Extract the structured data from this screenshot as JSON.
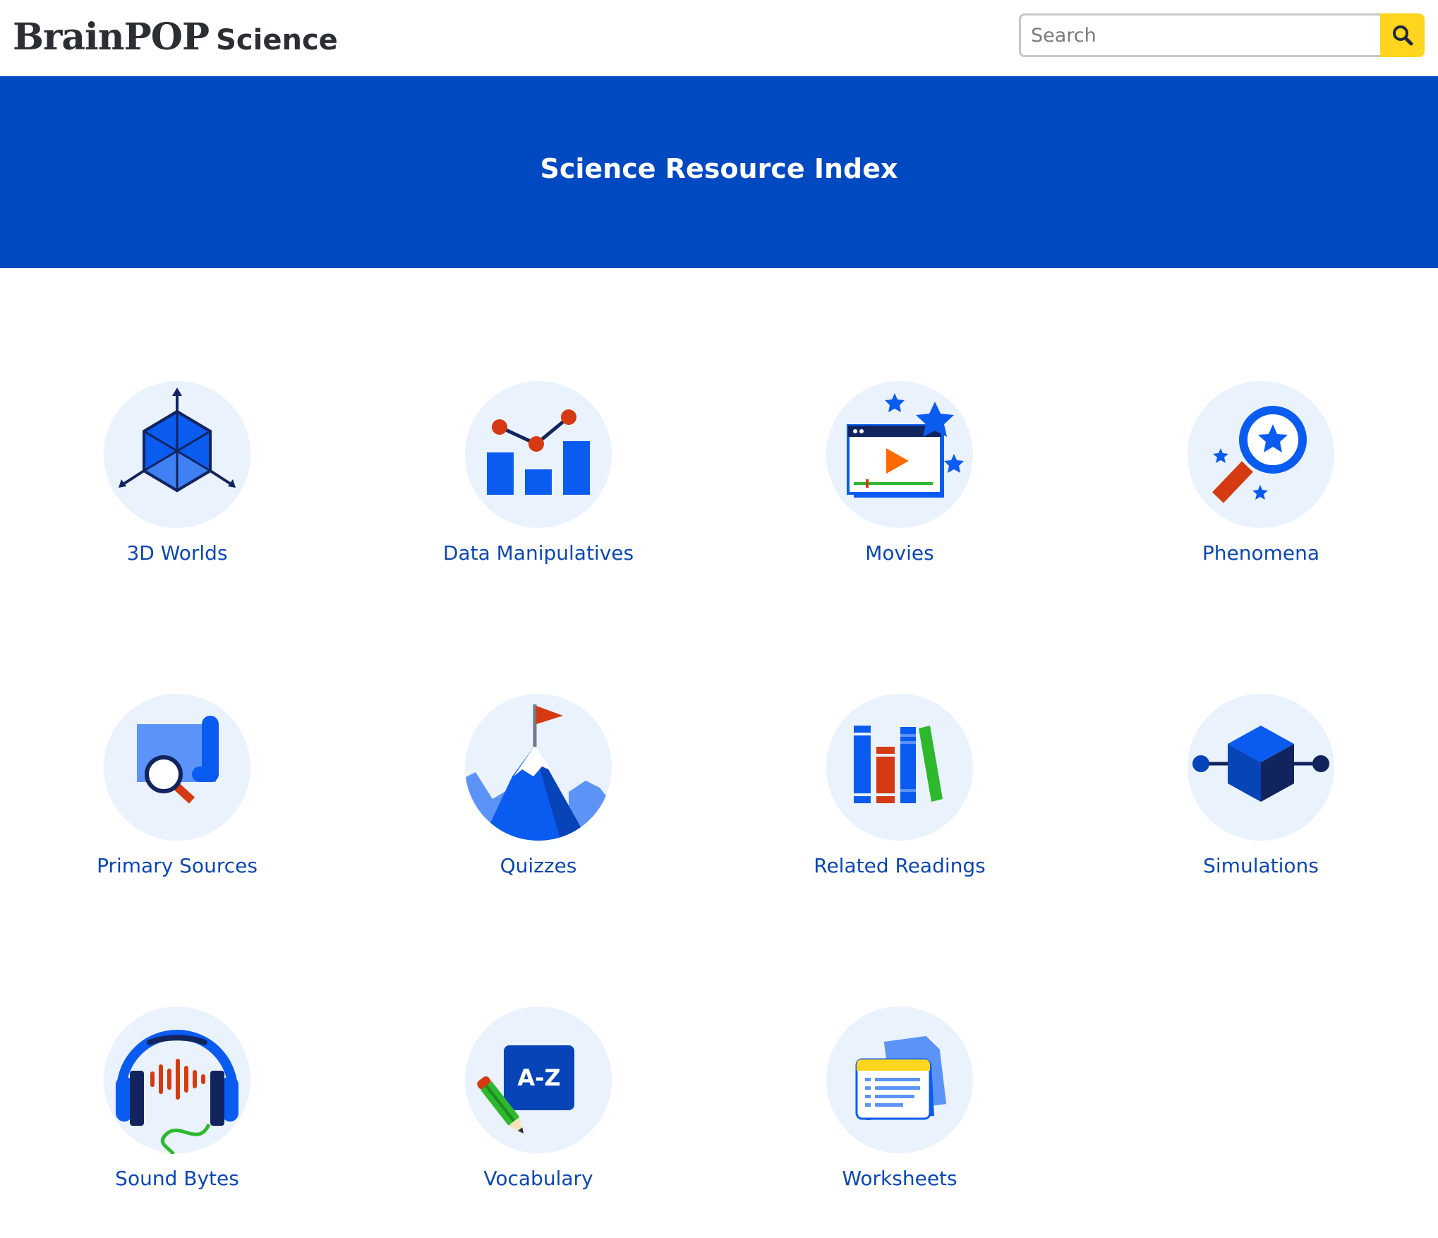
{
  "header": {
    "logo": {
      "brand": "BrainPOP",
      "product": "Science"
    },
    "search": {
      "placeholder": "Search",
      "value": ""
    }
  },
  "hero": {
    "title": "Science Resource Index"
  },
  "resources": [
    {
      "label": "3D Worlds",
      "icon": "3d-worlds-icon"
    },
    {
      "label": "Data Manipulatives",
      "icon": "data-manipulatives-icon"
    },
    {
      "label": "Movies",
      "icon": "movies-icon"
    },
    {
      "label": "Phenomena",
      "icon": "phenomena-icon"
    },
    {
      "label": "Primary Sources",
      "icon": "primary-sources-icon"
    },
    {
      "label": "Quizzes",
      "icon": "quizzes-icon"
    },
    {
      "label": "Related Readings",
      "icon": "related-readings-icon"
    },
    {
      "label": "Simulations",
      "icon": "simulations-icon"
    },
    {
      "label": "Sound Bytes",
      "icon": "sound-bytes-icon"
    },
    {
      "label": "Vocabulary",
      "icon": "vocabulary-icon",
      "badge": "A-Z"
    },
    {
      "label": "Worksheets",
      "icon": "worksheets-icon"
    }
  ],
  "colors": {
    "hero_background": "#0049c1",
    "search_button": "#ffd51d",
    "link_text": "#0b47b3",
    "icon_circle": "#eaf2fd"
  }
}
